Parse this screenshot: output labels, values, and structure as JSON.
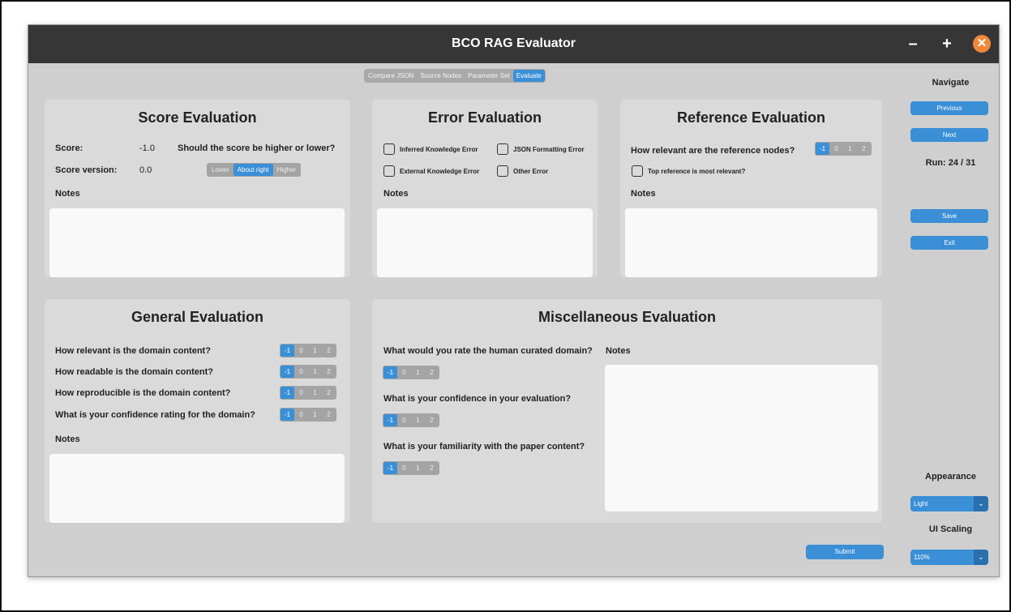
{
  "window": {
    "title": "BCO RAG Evaluator",
    "min_label": "–",
    "max_label": "+",
    "close_label": "✕"
  },
  "tabs": [
    "Compare JSON",
    "Source Nodes",
    "Parameter Set",
    "Evaluate"
  ],
  "score": {
    "title": "Score Evaluation",
    "score_label": "Score:",
    "score_value": "-1.0",
    "version_label": "Score version:",
    "version_value": "0.0",
    "question": "Should the score be higher or lower?",
    "options": [
      "Lower",
      "About right",
      "Higher"
    ],
    "notes_label": "Notes"
  },
  "error": {
    "title": "Error Evaluation",
    "checks": [
      "Inferred Knowledge Error",
      "JSON Formatting Error",
      "External Knowledge Error",
      "Other Error"
    ],
    "notes_label": "Notes"
  },
  "reference": {
    "title": "Reference Evaluation",
    "question": "How relevant are the reference nodes?",
    "check": "Top reference is most relevant?",
    "notes_label": "Notes"
  },
  "general": {
    "title": "General Evaluation",
    "questions": [
      "How relevant is the domain content?",
      "How readable is the domain content?",
      "How reproducible is the domain content?",
      "What is your confidence rating for the domain?"
    ],
    "notes_label": "Notes"
  },
  "misc": {
    "title": "Miscellaneous Evaluation",
    "questions": [
      "What would you rate the human curated domain?",
      "What is your confidence in your evaluation?",
      "What is your familiarity with the paper content?"
    ],
    "notes_label": "Notes"
  },
  "rating_options": [
    "-1",
    "0",
    "1",
    "2"
  ],
  "sidebar": {
    "navigate_label": "Navigate",
    "previous": "Previous",
    "next": "Next",
    "run": "Run: 24 / 31",
    "save": "Save",
    "exit": "Exit",
    "appearance_label": "Appearance",
    "appearance_value": "Light",
    "scaling_label": "UI Scaling",
    "scaling_value": "110%"
  },
  "submit": "Submit",
  "colors": {
    "accent": "#3a8fd6",
    "titlebar": "#363636",
    "close": "#f0883a",
    "panel": "#dadada"
  }
}
